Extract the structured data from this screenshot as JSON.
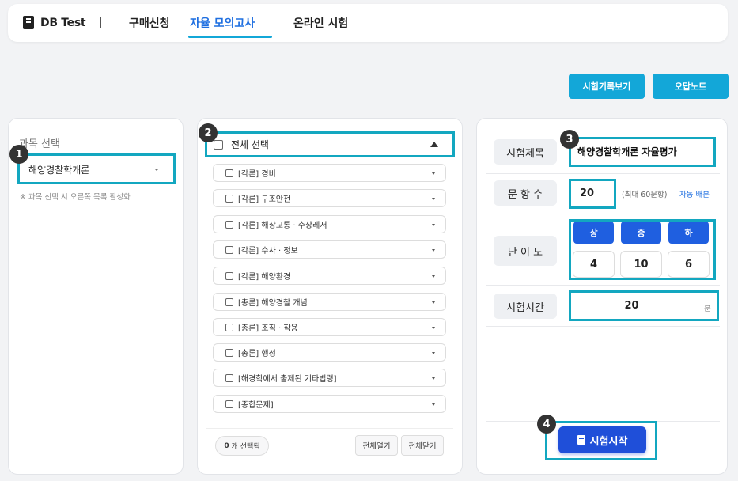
{
  "nav": {
    "logo_text": "DB Test",
    "tabs": [
      "구매신청",
      "자율 모의고사",
      "온라인 시험"
    ]
  },
  "top_buttons": {
    "history": "시험기록보기",
    "wrong_note": "오답노트"
  },
  "badges": [
    "1",
    "2",
    "3",
    "4"
  ],
  "subject_panel": {
    "title": "과목 선택",
    "selected": "해양경찰학개론",
    "note": "※ 과목 선택 시 오른쪽 목록 활성화"
  },
  "chapter_panel": {
    "select_all": "전체 선택",
    "items": [
      "[각론] 경비",
      "[각론] 구조안전",
      "[각론] 해상교통 · 수상레저",
      "[각론] 수사 · 정보",
      "[각론] 해양환경",
      "[총론] 해양경찰 개념",
      "[총론] 조직 · 작용",
      "[총론] 행정",
      "[해경학에서 출제된 기타법령]",
      "[종합문제]"
    ],
    "selected_count": "0",
    "selected_suffix": "개 선택됨",
    "expand_all": "전체열기",
    "collapse_all": "전체닫기"
  },
  "exam_panel": {
    "title_label": "시험제목",
    "title_value": "해양경찰학개론 자율평가",
    "count_label": "문 항 수",
    "count_value": "20",
    "count_max": "(최대 60문항)",
    "auto_distribute": "자동 배분",
    "difficulty_label": "난 이 도",
    "difficulty": [
      {
        "level": "상",
        "value": "4"
      },
      {
        "level": "중",
        "value": "10"
      },
      {
        "level": "하",
        "value": "6"
      }
    ],
    "time_label": "시험시간",
    "time_value": "20",
    "time_unit": "분",
    "start_button": "시험시작"
  }
}
